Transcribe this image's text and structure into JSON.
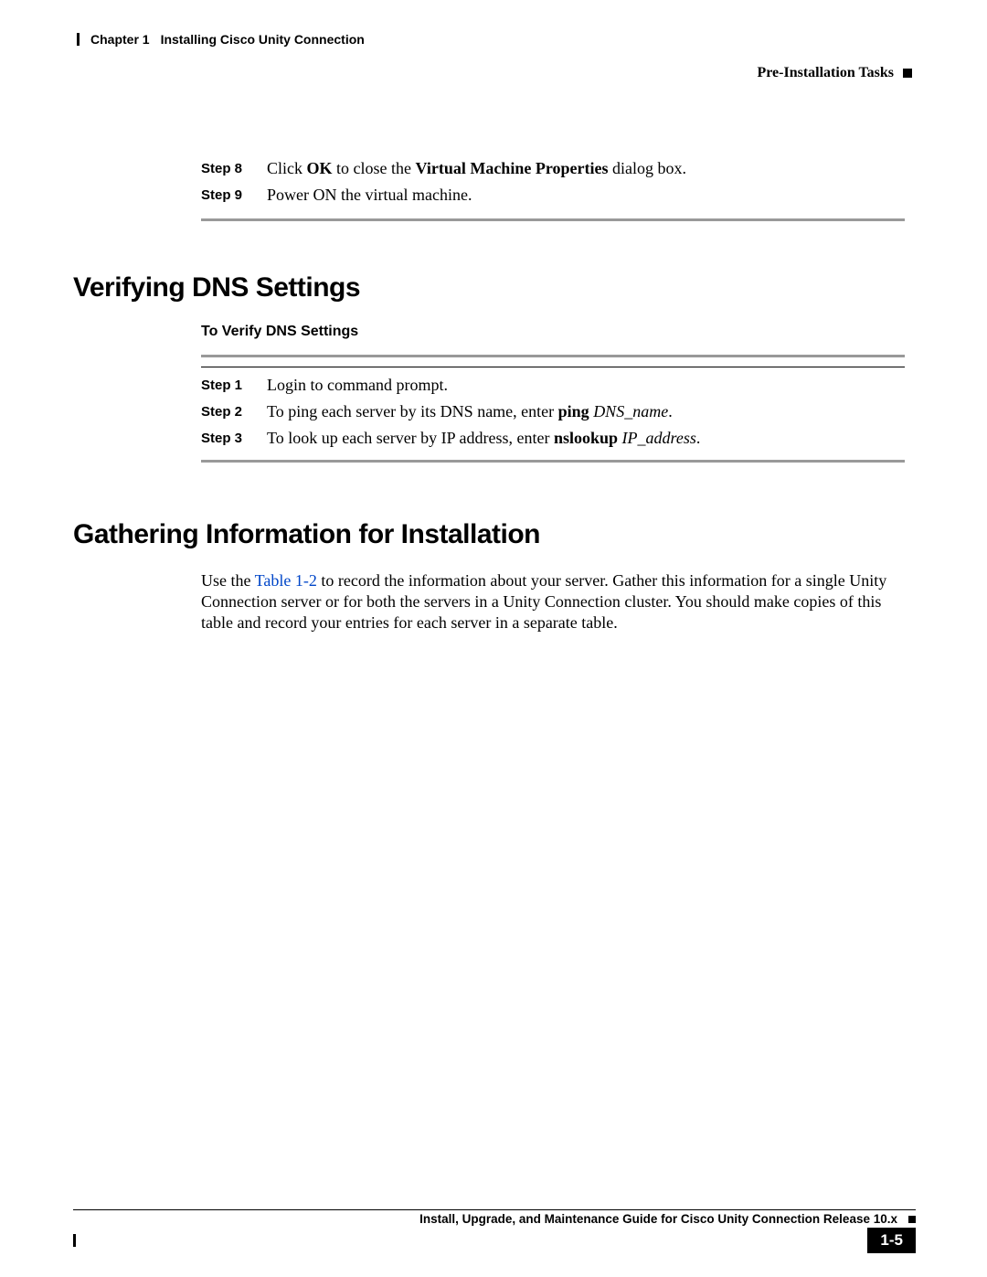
{
  "header": {
    "chapter_num": "Chapter 1",
    "chapter_title": "Installing Cisco Unity Connection",
    "section": "Pre-Installation Tasks"
  },
  "top_steps": [
    {
      "label": "Step 8",
      "prefix": "Click ",
      "bold1": "OK",
      "mid": " to close the ",
      "bold2": "Virtual Machine Properties",
      "suffix": " dialog box."
    },
    {
      "label": "Step 9",
      "text": "Power ON the virtual machine."
    }
  ],
  "section_verify": {
    "heading": "Verifying DNS Settings",
    "subheading": "To Verify DNS Settings",
    "steps": [
      {
        "label": "Step 1",
        "plain": "Login to command prompt."
      },
      {
        "label": "Step 2",
        "prefix": "To ping each server by its DNS name, enter ",
        "bold": "ping",
        "space": " ",
        "ital": "DNS_name",
        "suffix": "."
      },
      {
        "label": "Step 3",
        "prefix": "To look up each server by IP address, enter ",
        "bold": "nslookup",
        "space": " ",
        "ital": "IP_address",
        "suffix": "."
      }
    ]
  },
  "section_gather": {
    "heading": "Gathering Information for Installation",
    "para_prefix": "Use the ",
    "link": "Table 1-2",
    "para_suffix": " to record the information about your server. Gather this information for a single Unity Connection server or for both the servers in a Unity Connection cluster. You should make copies of this table and record your entries for each server in a separate table."
  },
  "footer": {
    "guide_title": "Install, Upgrade, and Maintenance Guide for Cisco Unity Connection Release 10.x",
    "page_num": "1-5"
  }
}
